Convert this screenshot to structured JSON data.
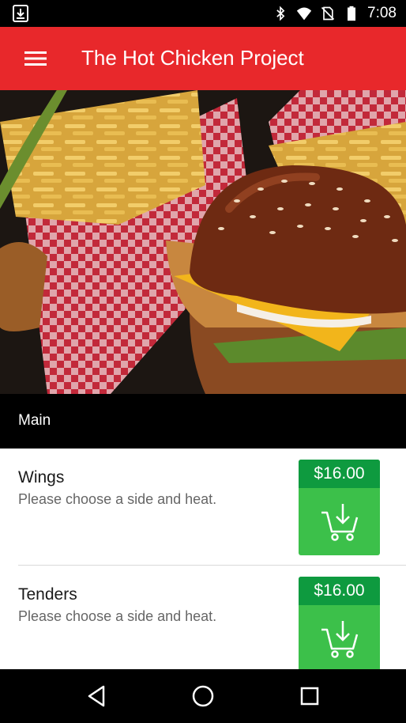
{
  "status_bar": {
    "time": "7:08",
    "icons": [
      "download-notification-icon",
      "bluetooth-icon",
      "wifi-icon",
      "no-sim-icon",
      "battery-icon"
    ]
  },
  "app_bar": {
    "title": "The Hot Chicken Project",
    "background_color": "#e8282b",
    "menu_icon": "hamburger-menu-icon"
  },
  "hero": {
    "image": "fried chicken burger with fries on checkered paper"
  },
  "section": {
    "title": "Main"
  },
  "menu_items": [
    {
      "name": "Wings",
      "description": "Please choose a side and heat.",
      "price": "$16.00",
      "cart_icon": "add-to-cart-icon"
    },
    {
      "name": "Tenders",
      "description": "Please choose a side and heat.",
      "price": "$16.00",
      "cart_icon": "add-to-cart-icon"
    }
  ],
  "colors": {
    "price_header": "#0e9a3f",
    "price_button": "#3cc04a"
  },
  "nav_bar": {
    "icons": [
      "back-icon",
      "home-icon",
      "recents-icon"
    ]
  }
}
